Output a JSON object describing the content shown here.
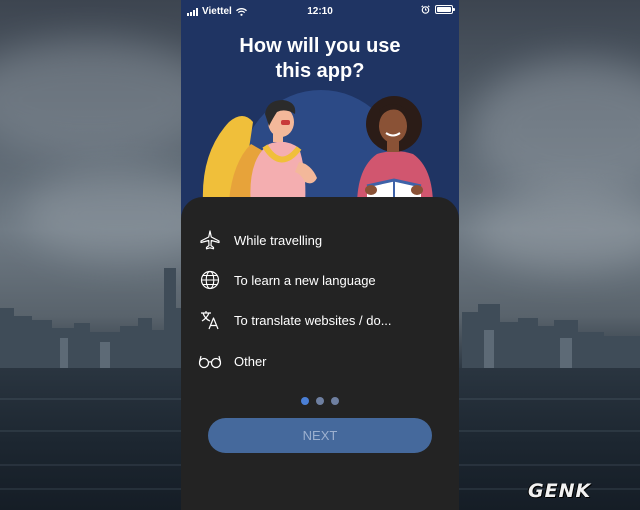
{
  "status_bar": {
    "carrier": "Viettel",
    "time": "12:10"
  },
  "onboarding": {
    "title_line1": "How will you use",
    "title_line2": "this app?",
    "options": [
      {
        "label": "While travelling",
        "icon": "airplane-icon"
      },
      {
        "label": "To learn a new language",
        "icon": "globe-icon"
      },
      {
        "label": "To translate websites / do...",
        "icon": "translate-icon"
      },
      {
        "label": "Other",
        "icon": "glasses-icon"
      }
    ],
    "page_indicator": {
      "total": 3,
      "current": 1
    },
    "next_label": "NEXT"
  },
  "watermark": "GENK",
  "colors": {
    "phone_header_bg": "#1f3463",
    "sheet_bg": "#232323",
    "next_button_bg": "#45699c",
    "active_dot": "#4a7fd6"
  }
}
